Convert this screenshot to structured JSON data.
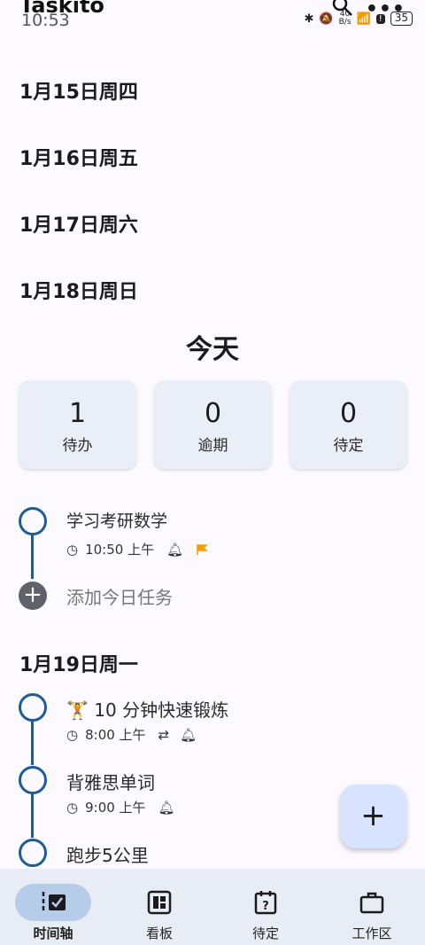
{
  "status": {
    "app_title": "Taskito",
    "time": "10:53",
    "net_speed_top": "40",
    "net_speed_bottom": "B/s",
    "battery": "35"
  },
  "dates": [
    "1月15日周四",
    "1月16日周五",
    "1月17日周六",
    "1月18日周日"
  ],
  "today": {
    "title": "今天",
    "stats": [
      {
        "value": "1",
        "label": "待办"
      },
      {
        "value": "0",
        "label": "逾期"
      },
      {
        "value": "0",
        "label": "待定"
      }
    ],
    "task": {
      "title": "学习考研数学",
      "time": "10:50 上午",
      "flag_color": "#f4a000"
    },
    "add_label": "添加今日任务"
  },
  "next_day": {
    "date": "1月19日周一",
    "tasks": [
      {
        "title": "🏋 10 分钟快速锻炼",
        "time": "8:00 上午",
        "repeat": true
      },
      {
        "title": "背雅思单词",
        "time": "9:00 上午",
        "repeat": false
      },
      {
        "title": "跑步5公里"
      }
    ]
  },
  "fab": {
    "label": "+"
  },
  "nav": [
    {
      "label": "时间轴",
      "icon": "timeline-icon",
      "active": true
    },
    {
      "label": "看板",
      "icon": "board-icon",
      "active": false
    },
    {
      "label": "待定",
      "icon": "calendar-question-icon",
      "active": false
    },
    {
      "label": "工作区",
      "icon": "briefcase-icon",
      "active": false
    }
  ],
  "colors": {
    "accent": "#1e5c96",
    "stat_bg": "#e9eef7",
    "nav_bg": "#e7ecf5",
    "nav_active": "#b6cde9",
    "fab_bg": "#d7e3ff"
  }
}
